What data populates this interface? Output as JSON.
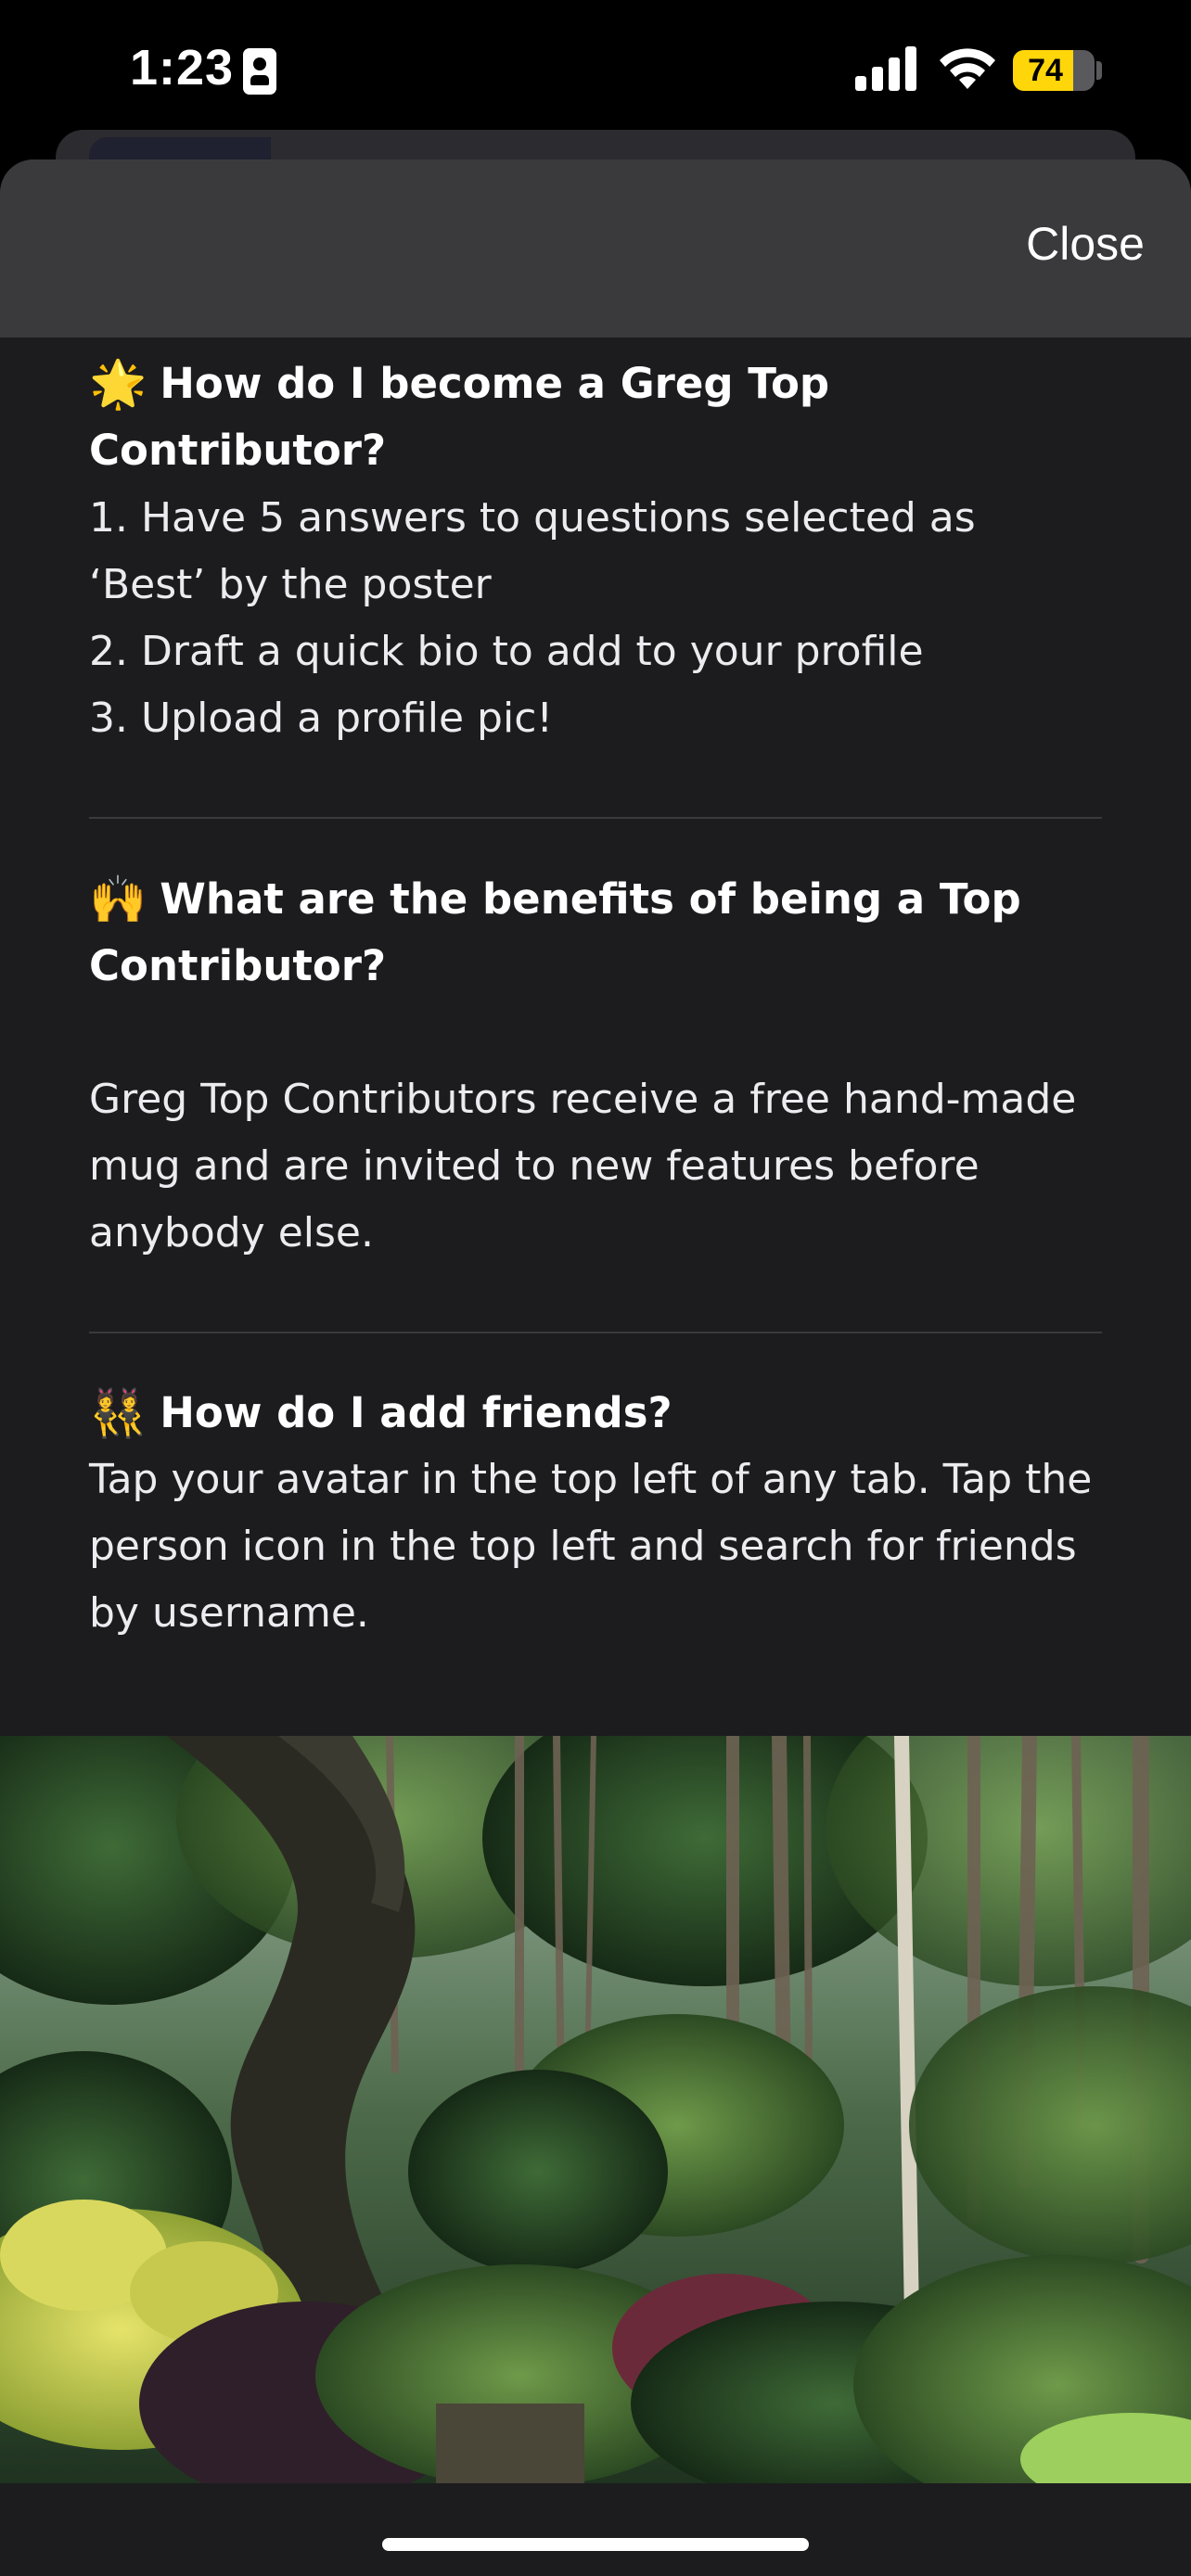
{
  "status_bar": {
    "time": "1:23",
    "battery_level": "74",
    "battery_fraction": 0.74,
    "battery_color": "#ffd60a",
    "icons": [
      "id-badge-icon",
      "signal-icon",
      "wifi-icon",
      "battery-icon"
    ]
  },
  "sheet": {
    "close_label": "Close",
    "header_color": "#3a3a3c",
    "background_color": "#1c1c1e"
  },
  "faq": [
    {
      "emoji": "🌟",
      "icon": "star-icon",
      "title": "How do I become a Greg Top Contributor?",
      "items": [
        "1. Have 5 answers to questions selected as ‘Best’ by the poster",
        "2. Draft a quick bio to add to your profile",
        "3. Upload a profile pic!"
      ]
    },
    {
      "emoji": "🙌",
      "icon": "raised-hands-icon",
      "title": "What are the benefits of being a Top Contributor?",
      "body": "Greg Top Contributors receive a free hand-made mug and are invited to new features before anybody else."
    },
    {
      "emoji": "👯",
      "icon": "people-icon",
      "title": "How do I add friends?",
      "body": "Tap your avatar in the top left of any tab. Tap the person icon in the top left and search for friends by username."
    }
  ],
  "footer_image": {
    "icon": "jungle-photo"
  }
}
